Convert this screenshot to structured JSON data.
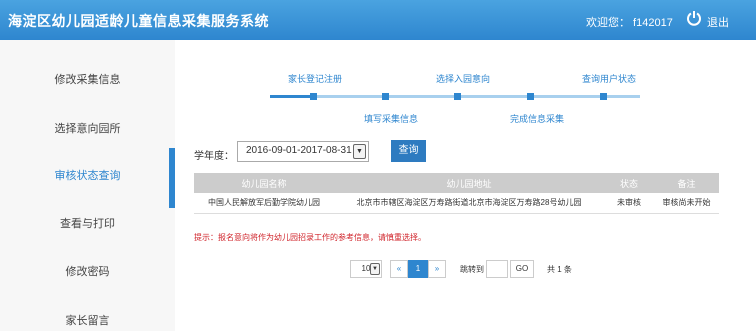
{
  "header": {
    "title": "海淀区幼儿园适龄儿童信息采集服务系统",
    "welcome": "欢迎您： f142017",
    "logout": "退出"
  },
  "sidebar": {
    "items": [
      {
        "label": "修改采集信息"
      },
      {
        "label": "选择意向园所"
      },
      {
        "label": "审核状态查询"
      },
      {
        "label": "查看与打印"
      },
      {
        "label": "修改密码"
      },
      {
        "label": "家长留言"
      }
    ]
  },
  "steps": {
    "top": [
      "家长登记注册",
      "选择入园意向",
      "查询用户状态"
    ],
    "bottom": [
      "填写采集信息",
      "完成信息采集"
    ]
  },
  "filter": {
    "year_label": "学年度：",
    "year_value": "2016-09-01-2017-08-31",
    "query_button": "查询"
  },
  "table": {
    "headers": [
      "幼儿园名称",
      "幼儿园地址",
      "状态",
      "备注"
    ],
    "rows": [
      [
        "中国人民解放军后勤学院幼儿园",
        "北京市市辖区海淀区万寿路街道北京市海淀区万寿路28号幼儿园",
        "未审核",
        "审核尚未开始"
      ]
    ]
  },
  "hint": "提示：报名意向将作为幼儿园招录工作的参考信息，请慎重选择。",
  "pager": {
    "page_size": "10",
    "prev": "«",
    "current": "1",
    "next": "»",
    "goto_label": "跳转到",
    "go_button": "GO",
    "total": "共 1 条"
  },
  "colors": {
    "accent": "#2e86cf",
    "hint": "#d0242b"
  }
}
